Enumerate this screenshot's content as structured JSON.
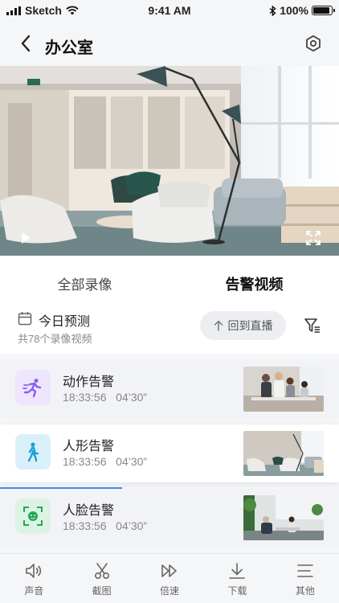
{
  "status": {
    "carrier": "Sketch",
    "time": "9:41 AM",
    "battery": "100%"
  },
  "nav": {
    "title": "办公室"
  },
  "tabs": [
    {
      "label": "全部录像"
    },
    {
      "label": "告警视频"
    }
  ],
  "filter": {
    "title": "今日预测",
    "subtitle": "共78个录像视频",
    "live_label": "回到直播"
  },
  "items": [
    {
      "title": "动作告警",
      "time": "18:33:56",
      "duration": "04’30”",
      "icon": "running-person-icon",
      "color": "#8a5cf6"
    },
    {
      "title": "人形告警",
      "time": "18:33:56",
      "duration": "04’30”",
      "icon": "walking-person-icon",
      "color": "#1aa0d6"
    },
    {
      "title": "人脸告警",
      "time": "18:33:56",
      "duration": "04’30”",
      "icon": "face-scan-icon",
      "color": "#22a858"
    }
  ],
  "playback_progress": 0.36,
  "toolbar": [
    {
      "label": "声音",
      "icon": "speaker-icon"
    },
    {
      "label": "截图",
      "icon": "scissors-icon"
    },
    {
      "label": "倍速",
      "icon": "fast-forward-icon"
    },
    {
      "label": "下载",
      "icon": "download-icon"
    },
    {
      "label": "其他",
      "icon": "menu-icon"
    }
  ]
}
